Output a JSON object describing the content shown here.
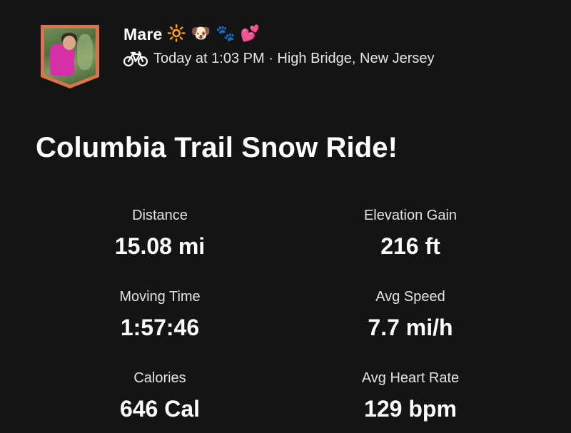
{
  "header": {
    "athlete_name": "Mare",
    "name_emojis": "🔆 🐶 🐾 💕",
    "activity_icon": "bike-icon",
    "meta": "Today at 1:03 PM · High Bridge, New Jersey"
  },
  "activity": {
    "title": "Columbia Trail Snow Ride!"
  },
  "stats": [
    {
      "label": "Distance",
      "value": "15.08 mi"
    },
    {
      "label": "Elevation Gain",
      "value": "216 ft"
    },
    {
      "label": "Moving Time",
      "value": "1:57:46"
    },
    {
      "label": "Avg Speed",
      "value": "7.7 mi/h"
    },
    {
      "label": "Calories",
      "value": "646 Cal"
    },
    {
      "label": "Avg Heart Rate",
      "value": "129 bpm"
    }
  ],
  "colors": {
    "background": "#151414",
    "text": "#ffffff",
    "badge_border": "#d9744b",
    "shirt": "#d82ea8"
  }
}
